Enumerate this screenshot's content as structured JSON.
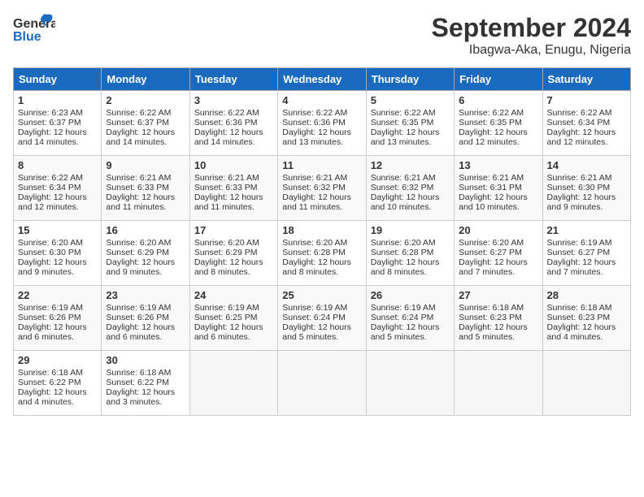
{
  "header": {
    "logo_general": "General",
    "logo_blue": "Blue",
    "month": "September 2024",
    "location": "Ibagwa-Aka, Enugu, Nigeria"
  },
  "weekdays": [
    "Sunday",
    "Monday",
    "Tuesday",
    "Wednesday",
    "Thursday",
    "Friday",
    "Saturday"
  ],
  "weeks": [
    [
      {
        "day": 1,
        "sunrise": "6:23 AM",
        "sunset": "6:37 PM",
        "daylight": "12 hours and 14 minutes."
      },
      {
        "day": 2,
        "sunrise": "6:22 AM",
        "sunset": "6:37 PM",
        "daylight": "12 hours and 14 minutes."
      },
      {
        "day": 3,
        "sunrise": "6:22 AM",
        "sunset": "6:36 PM",
        "daylight": "12 hours and 14 minutes."
      },
      {
        "day": 4,
        "sunrise": "6:22 AM",
        "sunset": "6:36 PM",
        "daylight": "12 hours and 13 minutes."
      },
      {
        "day": 5,
        "sunrise": "6:22 AM",
        "sunset": "6:35 PM",
        "daylight": "12 hours and 13 minutes."
      },
      {
        "day": 6,
        "sunrise": "6:22 AM",
        "sunset": "6:35 PM",
        "daylight": "12 hours and 12 minutes."
      },
      {
        "day": 7,
        "sunrise": "6:22 AM",
        "sunset": "6:34 PM",
        "daylight": "12 hours and 12 minutes."
      }
    ],
    [
      {
        "day": 8,
        "sunrise": "6:22 AM",
        "sunset": "6:34 PM",
        "daylight": "12 hours and 12 minutes."
      },
      {
        "day": 9,
        "sunrise": "6:21 AM",
        "sunset": "6:33 PM",
        "daylight": "12 hours and 11 minutes."
      },
      {
        "day": 10,
        "sunrise": "6:21 AM",
        "sunset": "6:33 PM",
        "daylight": "12 hours and 11 minutes."
      },
      {
        "day": 11,
        "sunrise": "6:21 AM",
        "sunset": "6:32 PM",
        "daylight": "12 hours and 11 minutes."
      },
      {
        "day": 12,
        "sunrise": "6:21 AM",
        "sunset": "6:32 PM",
        "daylight": "12 hours and 10 minutes."
      },
      {
        "day": 13,
        "sunrise": "6:21 AM",
        "sunset": "6:31 PM",
        "daylight": "12 hours and 10 minutes."
      },
      {
        "day": 14,
        "sunrise": "6:21 AM",
        "sunset": "6:30 PM",
        "daylight": "12 hours and 9 minutes."
      }
    ],
    [
      {
        "day": 15,
        "sunrise": "6:20 AM",
        "sunset": "6:30 PM",
        "daylight": "12 hours and 9 minutes."
      },
      {
        "day": 16,
        "sunrise": "6:20 AM",
        "sunset": "6:29 PM",
        "daylight": "12 hours and 9 minutes."
      },
      {
        "day": 17,
        "sunrise": "6:20 AM",
        "sunset": "6:29 PM",
        "daylight": "12 hours and 8 minutes."
      },
      {
        "day": 18,
        "sunrise": "6:20 AM",
        "sunset": "6:28 PM",
        "daylight": "12 hours and 8 minutes."
      },
      {
        "day": 19,
        "sunrise": "6:20 AM",
        "sunset": "6:28 PM",
        "daylight": "12 hours and 8 minutes."
      },
      {
        "day": 20,
        "sunrise": "6:20 AM",
        "sunset": "6:27 PM",
        "daylight": "12 hours and 7 minutes."
      },
      {
        "day": 21,
        "sunrise": "6:19 AM",
        "sunset": "6:27 PM",
        "daylight": "12 hours and 7 minutes."
      }
    ],
    [
      {
        "day": 22,
        "sunrise": "6:19 AM",
        "sunset": "6:26 PM",
        "daylight": "12 hours and 6 minutes."
      },
      {
        "day": 23,
        "sunrise": "6:19 AM",
        "sunset": "6:26 PM",
        "daylight": "12 hours and 6 minutes."
      },
      {
        "day": 24,
        "sunrise": "6:19 AM",
        "sunset": "6:25 PM",
        "daylight": "12 hours and 6 minutes."
      },
      {
        "day": 25,
        "sunrise": "6:19 AM",
        "sunset": "6:24 PM",
        "daylight": "12 hours and 5 minutes."
      },
      {
        "day": 26,
        "sunrise": "6:19 AM",
        "sunset": "6:24 PM",
        "daylight": "12 hours and 5 minutes."
      },
      {
        "day": 27,
        "sunrise": "6:18 AM",
        "sunset": "6:23 PM",
        "daylight": "12 hours and 5 minutes."
      },
      {
        "day": 28,
        "sunrise": "6:18 AM",
        "sunset": "6:23 PM",
        "daylight": "12 hours and 4 minutes."
      }
    ],
    [
      {
        "day": 29,
        "sunrise": "6:18 AM",
        "sunset": "6:22 PM",
        "daylight": "12 hours and 4 minutes."
      },
      {
        "day": 30,
        "sunrise": "6:18 AM",
        "sunset": "6:22 PM",
        "daylight": "12 hours and 3 minutes."
      },
      null,
      null,
      null,
      null,
      null
    ]
  ]
}
